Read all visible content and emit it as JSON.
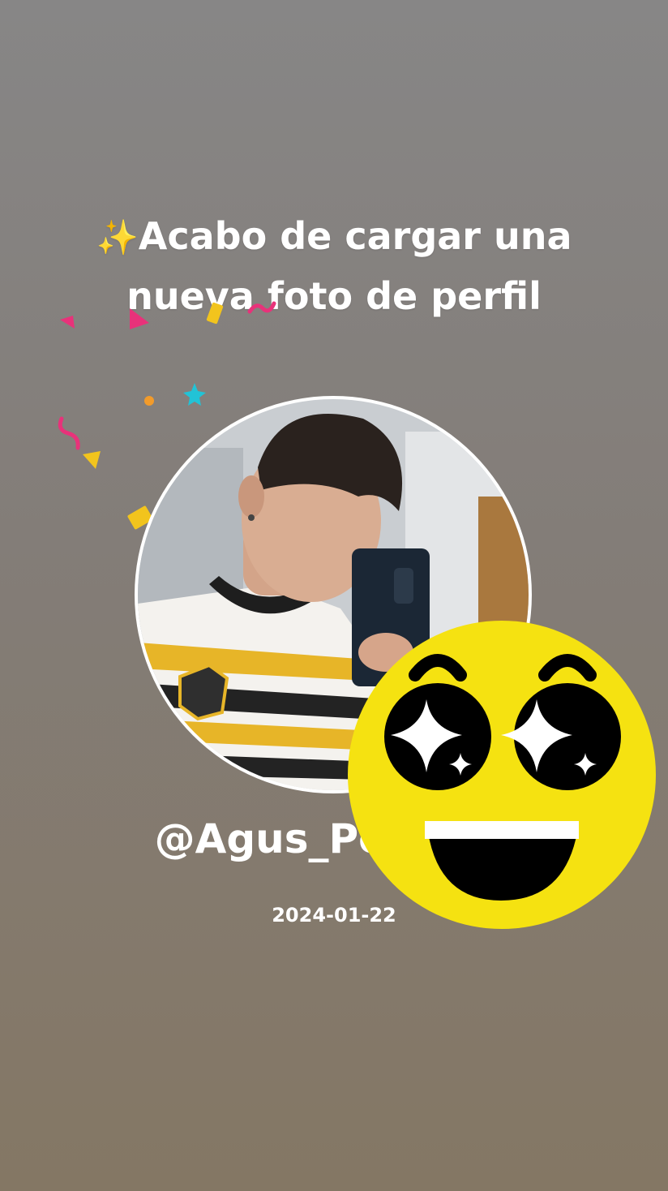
{
  "story": {
    "sparkle_icon": "✨",
    "headline": "Acabo de cargar una nueva foto de perfil",
    "username": "@Agus_Perez21",
    "date": "2024-01-22"
  },
  "icons": {
    "sticker": "star-struck-emoji-icon",
    "decoration": "confetti-icon"
  },
  "colors": {
    "text": "#ffffff",
    "emoji_yellow": "#f5e211",
    "confetti_pink": "#e8327a",
    "confetti_yellow": "#f2c41d",
    "confetti_cyan": "#22c3d6",
    "confetti_orange": "#f29b2b"
  }
}
